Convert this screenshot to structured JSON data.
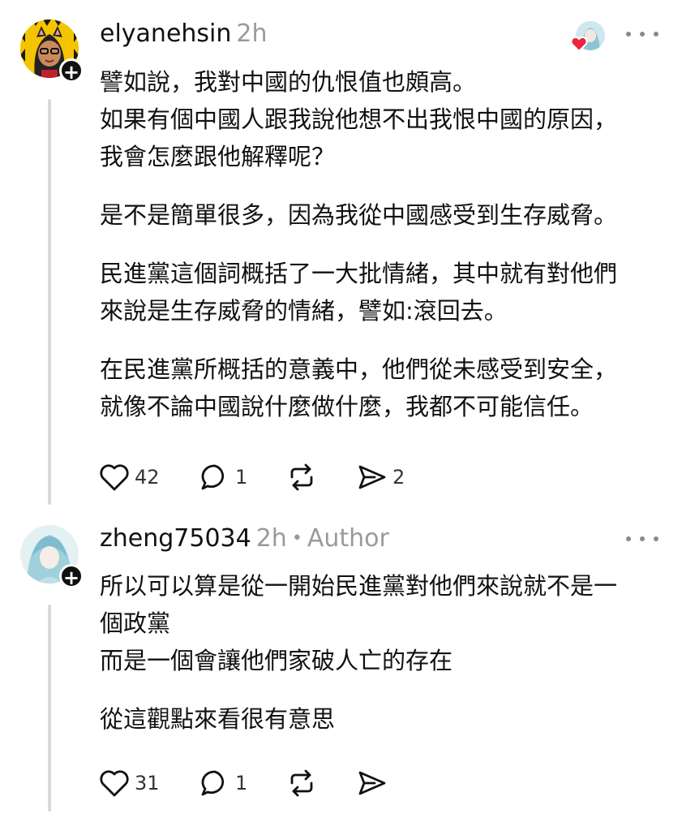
{
  "posts": [
    {
      "username": "elyanehsin",
      "time": "2h",
      "author_tag": "",
      "paragraphs": [
        [
          "譬如說，我對中國的仇恨值也頗高。",
          "如果有個中國人跟我說他想不出我恨中國的原因，",
          "我會怎麼跟他解釋呢？"
        ],
        [
          "是不是簡單很多，因為我從中國感受到生存威脅。"
        ],
        [
          "民進黨這個詞概括了一大批情緒，其中就有對他們",
          "來說是生存威脅的情緒，譬如:滾回去。"
        ],
        [
          "在民進黨所概括的意義中，他們從未感受到安全，",
          "就像不論中國說什麼做什麼，我都不可能信任。"
        ]
      ],
      "likes": "42",
      "replies": "1",
      "reposts": "",
      "shares": "2",
      "icons": {
        "like": "heart-icon",
        "reply": "speech-bubble-icon",
        "repost": "repost-icon",
        "share": "send-icon",
        "more": "more-icon"
      }
    },
    {
      "username": "zheng75034",
      "time": "2h",
      "author_tag": "Author",
      "paragraphs": [
        [
          "所以可以算是從一開始民進黨對他們來說就不是一",
          "個政黨",
          "而是一個會讓他們家破人亡的存在"
        ],
        [
          "從這觀點來看很有意思"
        ]
      ],
      "likes": "31",
      "replies": "1",
      "reposts": "",
      "shares": "",
      "icons": {
        "like": "heart-icon",
        "reply": "speech-bubble-icon",
        "repost": "repost-icon",
        "share": "send-icon",
        "more": "more-icon"
      }
    }
  ],
  "colors": {
    "text": "#111111",
    "meta": "#9a9a9a",
    "thread": "#d9d9d9",
    "heart_badge": "#e8283c"
  }
}
